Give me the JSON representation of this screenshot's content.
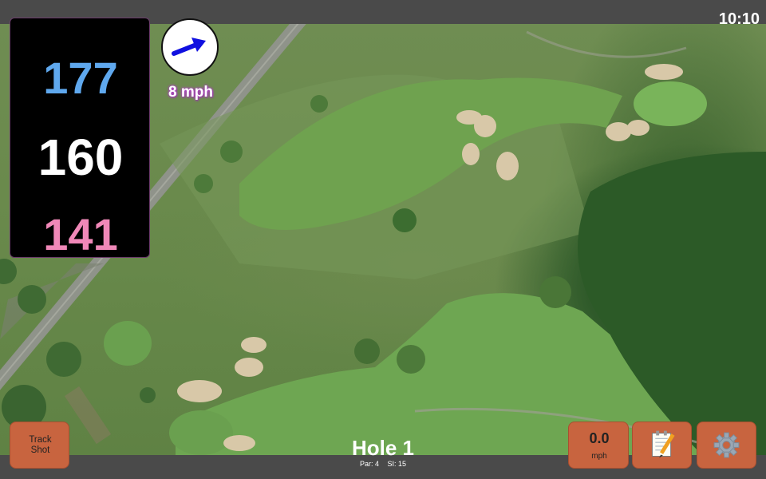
{
  "status_bar": {
    "time": "10:10"
  },
  "distances": {
    "back": "177",
    "middle": "160",
    "front": "141"
  },
  "wind": {
    "speed": "8 mph",
    "icon": "wind-direction-arrow-icon"
  },
  "hole": {
    "title": "Hole 1",
    "par": "Par: 4",
    "stroke_index": "SI: 15"
  },
  "buttons": {
    "track_shot": "Track\nShot",
    "speed_value": "0.0",
    "speed_unit": "mph",
    "notes_icon": "notepad-pencil-icon",
    "settings_icon": "gear-icon"
  },
  "colors": {
    "back_distance": "#5fa8ee",
    "middle_distance": "#ffffff",
    "front_distance": "#f088b8",
    "button_bg": "#c8643f",
    "wind_arrow": "#1010e0"
  }
}
